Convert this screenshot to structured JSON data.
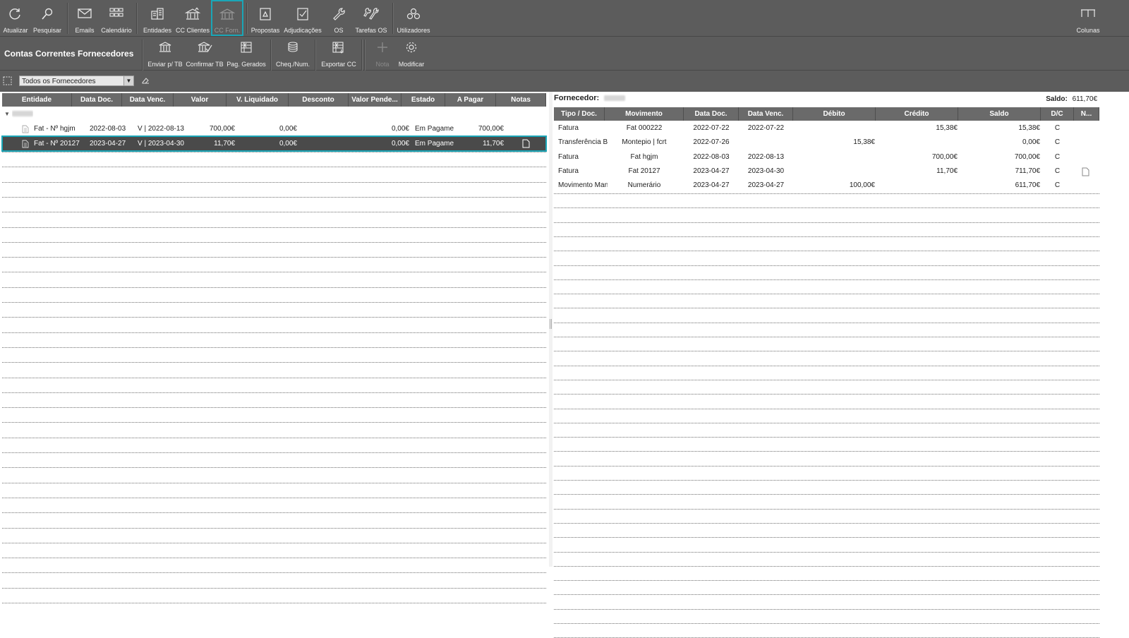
{
  "toolbar": {
    "buttons": [
      {
        "label": "Atualizar",
        "icon": "refresh-icon"
      },
      {
        "label": "Pesquisar",
        "icon": "search-icon"
      },
      {
        "label": "Emails",
        "icon": "mail-icon"
      },
      {
        "label": "Calendário",
        "icon": "calendar-grid-icon"
      },
      {
        "label": "Entidades",
        "icon": "entities-icon"
      },
      {
        "label": "CC Clientes",
        "icon": "bank-up-icon"
      },
      {
        "label": "CC Forn.",
        "icon": "bank-down-icon"
      },
      {
        "label": "Propostas",
        "icon": "proposal-icon"
      },
      {
        "label": "Adjudicações",
        "icon": "check-doc-icon"
      },
      {
        "label": "OS",
        "icon": "wrench-icon"
      },
      {
        "label": "Tarefas OS",
        "icon": "tools-icon"
      },
      {
        "label": "Utilizadores",
        "icon": "users-icon"
      },
      {
        "label": "Colunas",
        "icon": "columns-icon"
      }
    ]
  },
  "section": {
    "title": "Contas Correntes Fornecedores",
    "actions": [
      {
        "label": "Enviar p/ TB",
        "icon": "bank-icon"
      },
      {
        "label": "Confirmar TB",
        "icon": "confirm-bank-icon"
      },
      {
        "label": "Pag. Gerados",
        "icon": "excel-icon"
      },
      {
        "label": "Cheq./Num.",
        "icon": "coins-icon"
      },
      {
        "label": "Exportar CC",
        "icon": "export-excel-icon"
      },
      {
        "label": "Nota",
        "icon": "plus-icon"
      },
      {
        "label": "Modificar",
        "icon": "gear-icon"
      }
    ]
  },
  "filter": {
    "selected": "Todos os Fornecedores"
  },
  "left_table": {
    "headers": [
      "Entidade",
      "Data Doc.",
      "Data Venc.",
      "Valor",
      "V. Liquidado",
      "Desconto",
      "Valor Pende...",
      "Estado",
      "A Pagar",
      "Notas"
    ],
    "rows": [
      {
        "entidade": "Fat - Nº hgjm",
        "data_doc": "2022-08-03",
        "data_venc": "V | 2022-08-13",
        "valor": "700,00€",
        "v_liquidado": "0,00€",
        "desconto": "",
        "valor_pendente": "0,00€",
        "estado": "Em Pagame",
        "a_pagar": "700,00€",
        "nota": false
      },
      {
        "entidade": "Fat - Nº 20127",
        "data_doc": "2023-04-27",
        "data_venc": "V | 2023-04-30",
        "valor": "11,70€",
        "v_liquidado": "0,00€",
        "desconto": "",
        "valor_pendente": "0,00€",
        "estado": "Em Pagame",
        "a_pagar": "11,70€",
        "nota": true
      }
    ]
  },
  "right_panel": {
    "fornecedor_label": "Fornecedor:",
    "saldo_label": "Saldo:",
    "saldo_value": "611,70€",
    "headers": [
      "Tipo / Doc.",
      "Movimento",
      "Data Doc.",
      "Data Venc.",
      "Débito",
      "Crédito",
      "Saldo",
      "D/C",
      "N..."
    ],
    "rows": [
      {
        "tipo": "Fatura",
        "movimento": "Fat 000222",
        "data_doc": "2022-07-22",
        "data_venc": "2022-07-22",
        "debito": "",
        "credito": "15,38€",
        "saldo": "15,38€",
        "dc": "C",
        "nota": false
      },
      {
        "tipo": "Transferência B",
        "movimento": "Montepio | fcrt",
        "data_doc": "2022-07-26",
        "data_venc": "",
        "debito": "15,38€",
        "credito": "",
        "saldo": "0,00€",
        "dc": "C",
        "nota": false
      },
      {
        "tipo": "Fatura",
        "movimento": "Fat hgjm",
        "data_doc": "2022-08-03",
        "data_venc": "2022-08-13",
        "debito": "",
        "credito": "700,00€",
        "saldo": "700,00€",
        "dc": "C",
        "nota": false
      },
      {
        "tipo": "Fatura",
        "movimento": "Fat 20127",
        "data_doc": "2023-04-27",
        "data_venc": "2023-04-30",
        "debito": "",
        "credito": "11,70€",
        "saldo": "711,70€",
        "dc": "C",
        "nota": true
      },
      {
        "tipo": "Movimento Man",
        "movimento": "Numerário",
        "data_doc": "2023-04-27",
        "data_venc": "2023-04-27",
        "debito": "100,00€",
        "credito": "",
        "saldo": "611,70€",
        "dc": "C",
        "nota": false
      }
    ]
  },
  "colors": {
    "toolbar_bg": "#5c5c5c",
    "accent": "#1aa6b7",
    "header_bg": "#6a6a6a"
  }
}
